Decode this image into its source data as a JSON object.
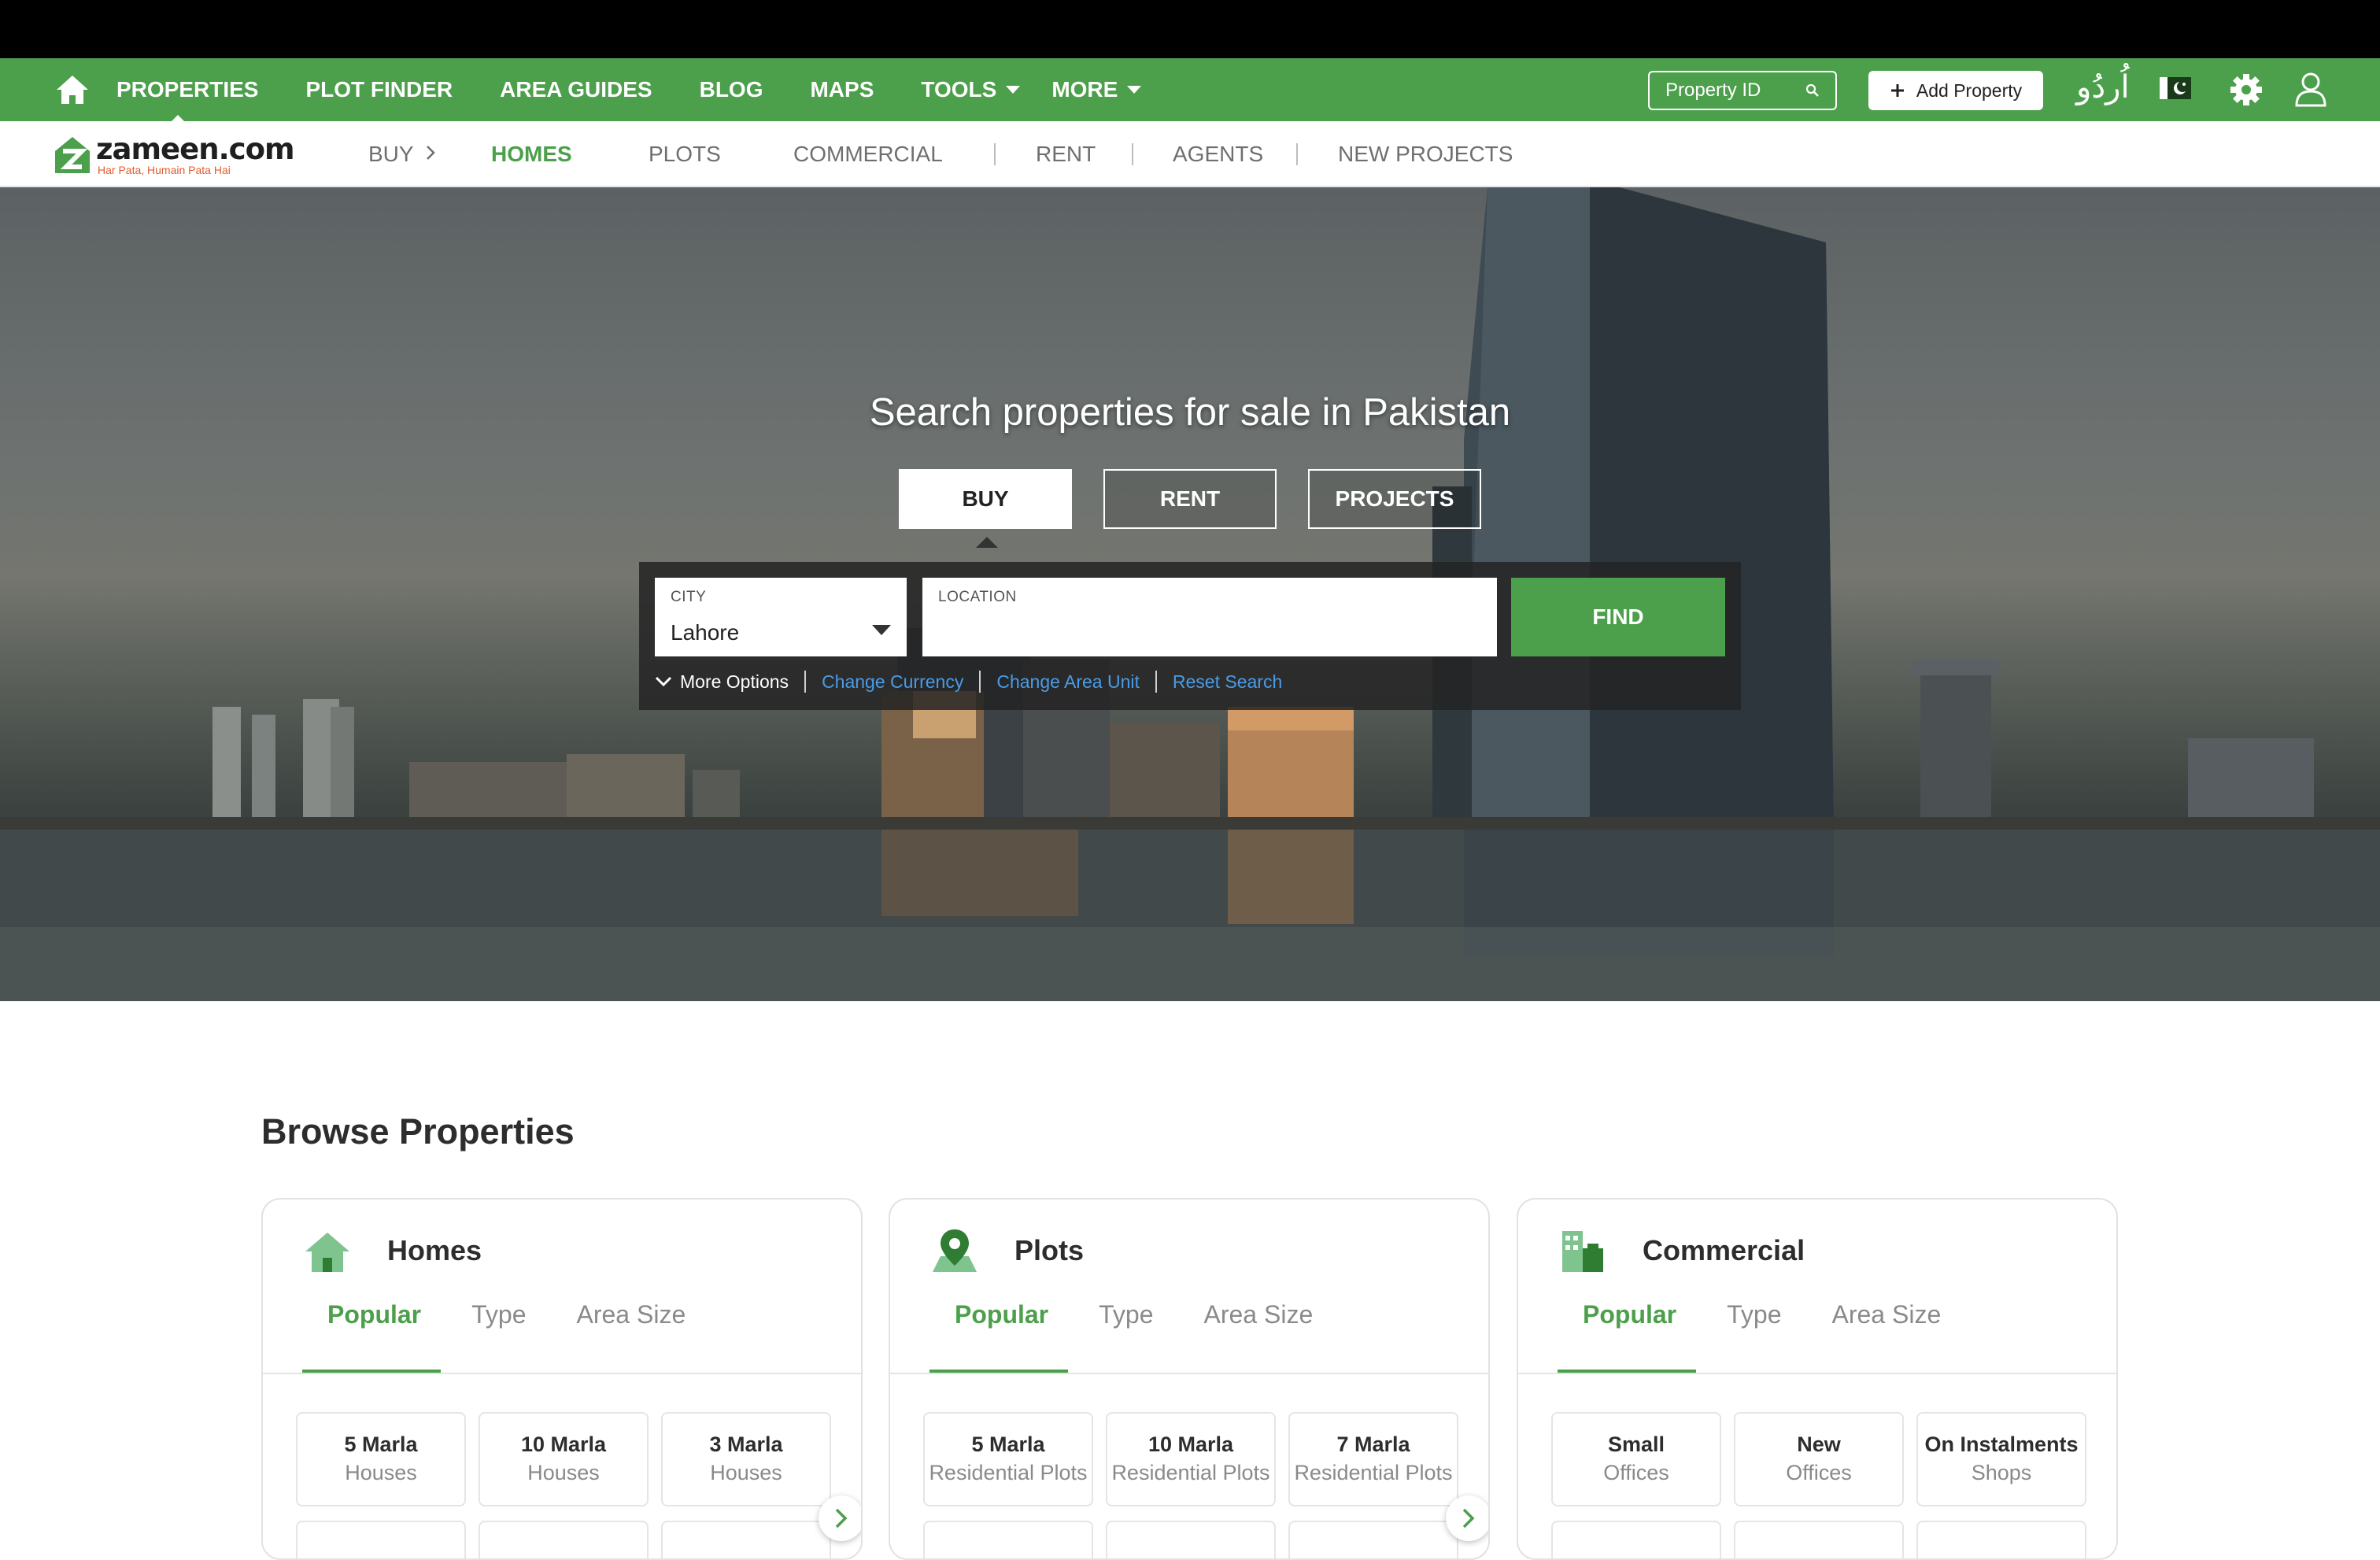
{
  "top_nav": {
    "items": [
      {
        "label": "PROPERTIES",
        "active": true
      },
      {
        "label": "PLOT FINDER"
      },
      {
        "label": "AREA GUIDES"
      },
      {
        "label": "BLOG"
      },
      {
        "label": "MAPS"
      },
      {
        "label": "TOOLS",
        "dropdown": true
      },
      {
        "label": "MORE",
        "dropdown": true
      }
    ],
    "property_id_placeholder": "Property ID",
    "add_property_label": "Add Property",
    "language_label": "اُردُو",
    "brand_color": "#4c9f4b"
  },
  "sub_nav": {
    "logo_text": "zameen.com",
    "logo_tagline": "Har Pata, Humain Pata Hai",
    "buy_label": "BUY",
    "items": [
      "HOMES",
      "PLOTS",
      "COMMERCIAL",
      "RENT",
      "AGENTS",
      "NEW PROJECTS"
    ],
    "active": "HOMES"
  },
  "hero": {
    "title": "Search properties for sale in Pakistan",
    "tabs": [
      "BUY",
      "RENT",
      "PROJECTS"
    ],
    "active_tab": "BUY",
    "city_label": "CITY",
    "city_value": "Lahore",
    "location_label": "LOCATION",
    "location_value": "",
    "find_label": "FIND",
    "more_options": "More Options",
    "links": [
      "Change Currency",
      "Change Area Unit",
      "Reset Search"
    ],
    "link_color": "#4a9be6"
  },
  "browse": {
    "title": "Browse Properties",
    "cards": [
      {
        "title": "Homes",
        "icon": "house-icon",
        "tabs": [
          "Popular",
          "Type",
          "Area Size"
        ],
        "tiles": [
          {
            "line1": "5 Marla",
            "line2": "Houses"
          },
          {
            "line1": "10 Marla",
            "line2": "Houses"
          },
          {
            "line1": "3 Marla",
            "line2": "Houses"
          }
        ]
      },
      {
        "title": "Plots",
        "icon": "map-pin-icon",
        "tabs": [
          "Popular",
          "Type",
          "Area Size"
        ],
        "tiles": [
          {
            "line1": "5 Marla",
            "line2": "Residential Plots"
          },
          {
            "line1": "10 Marla",
            "line2": "Residential Plots"
          },
          {
            "line1": "7 Marla",
            "line2": "Residential Plots"
          }
        ]
      },
      {
        "title": "Commercial",
        "icon": "building-icon",
        "tabs": [
          "Popular",
          "Type",
          "Area Size"
        ],
        "tiles": [
          {
            "line1": "Small",
            "line2": "Offices"
          },
          {
            "line1": "New",
            "line2": "Offices"
          },
          {
            "line1": "On Instalments",
            "line2": "Shops"
          }
        ]
      }
    ]
  }
}
